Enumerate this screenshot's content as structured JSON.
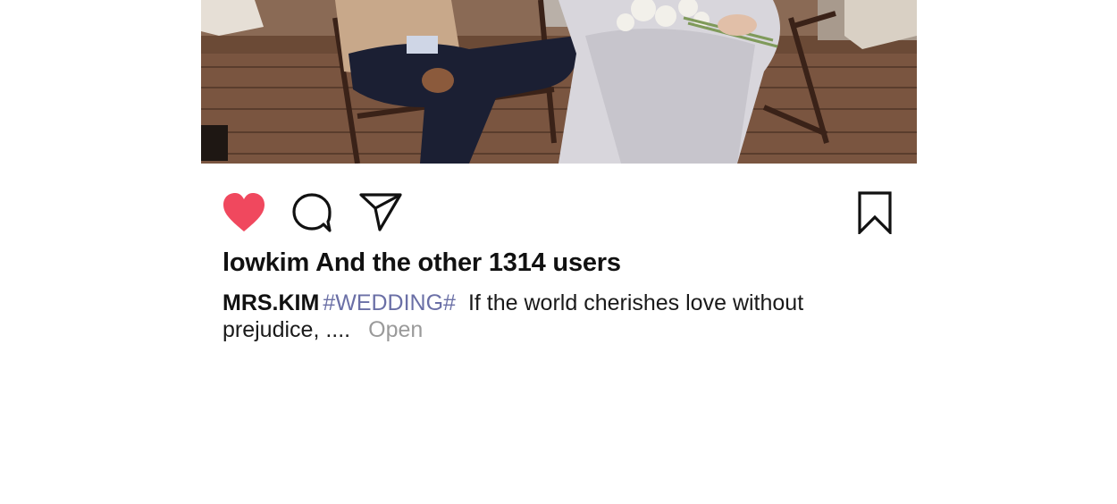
{
  "post": {
    "image_alt": "Wedding couple seated on folding chairs on a wooden deck",
    "likes": {
      "user": "lowkim",
      "suffix": "And the other 1314 users"
    },
    "caption": {
      "author": "MRS.KIM",
      "hashtag": "#WEDDING#",
      "text_line1": "If the world cherishes love without",
      "text_line2": "prejudice, ....",
      "more_label": "Open"
    },
    "actions": {
      "like_icon": "heart-icon",
      "comment_icon": "comment-bubble-icon",
      "share_icon": "paper-plane-icon",
      "save_icon": "bookmark-icon"
    },
    "colors": {
      "like_active": "#f0485e",
      "hashtag": "#6a6fa6",
      "more": "#9a9a9a"
    }
  }
}
